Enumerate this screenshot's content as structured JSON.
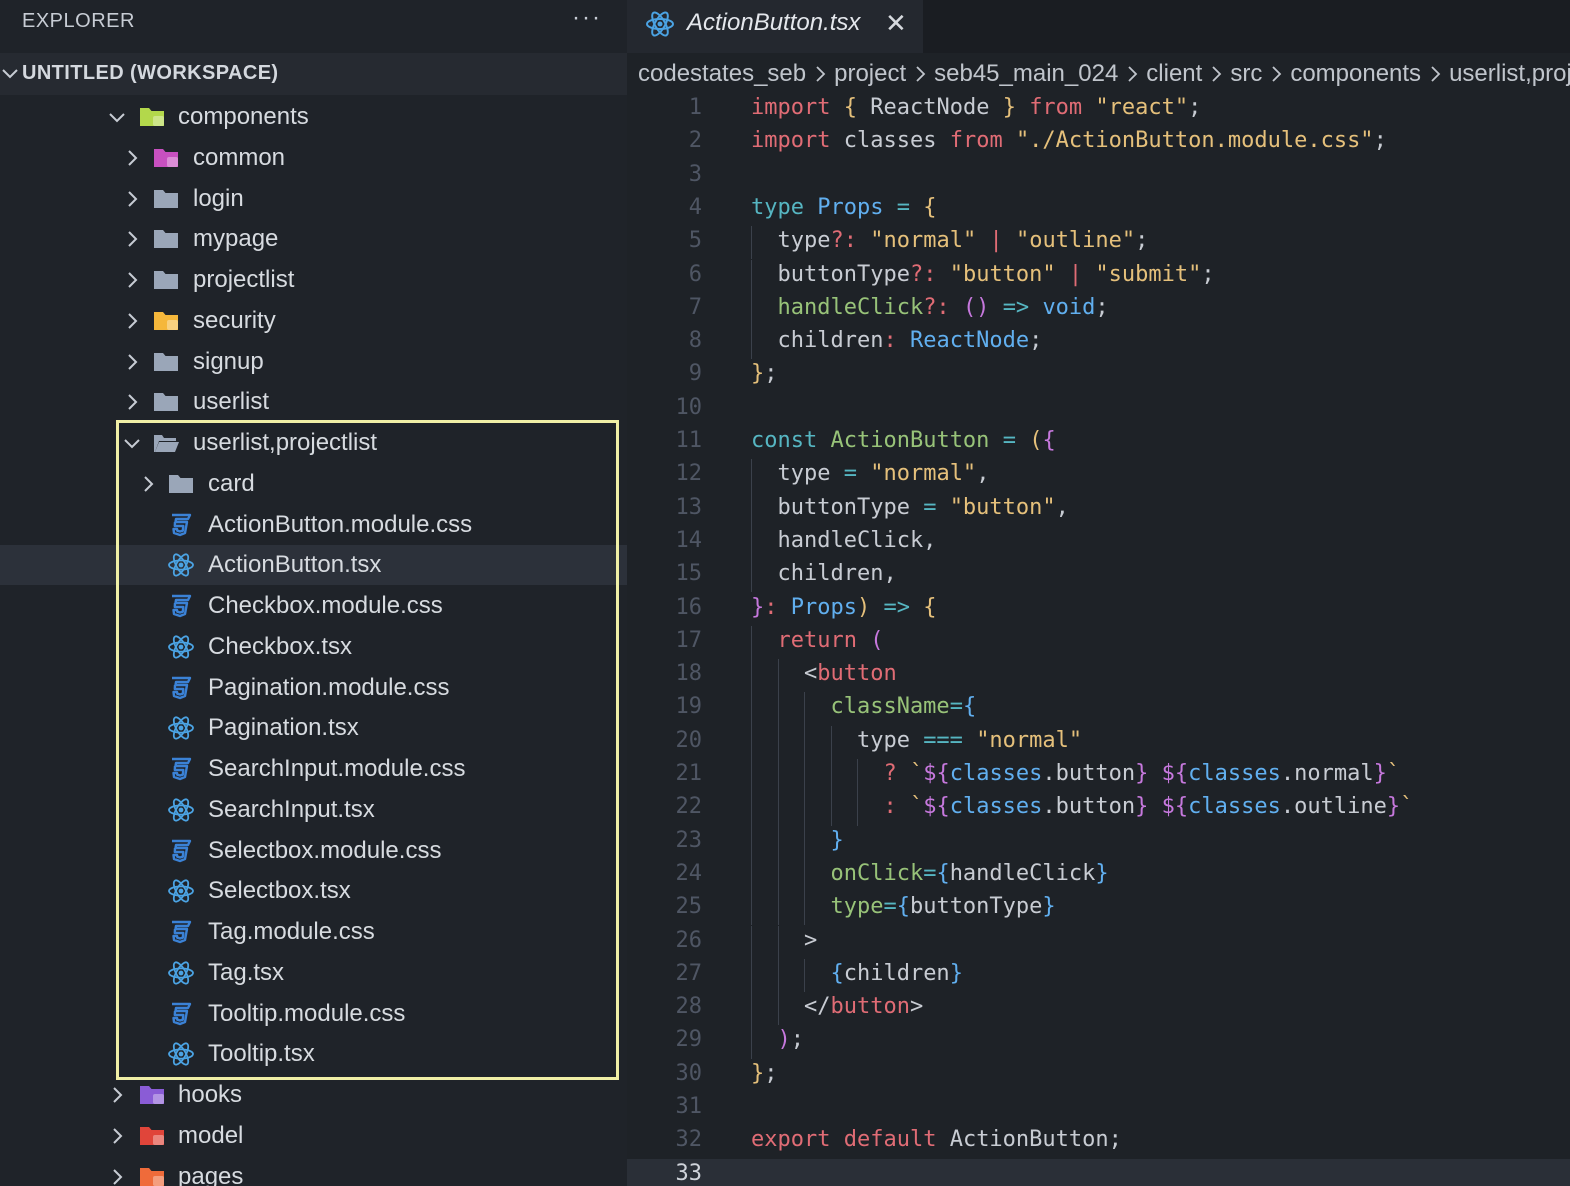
{
  "sidebar": {
    "title": "EXPLORER",
    "more_label": "···",
    "workspace_label": "UNTITLED (WORKSPACE)",
    "tree": [
      {
        "label": "components",
        "type": "folder-special",
        "expanded": true,
        "depth": 0,
        "color": "#b3d84b"
      },
      {
        "label": "common",
        "type": "folder-special",
        "expanded": false,
        "depth": 1,
        "color": "#c850c0"
      },
      {
        "label": "login",
        "type": "folder",
        "expanded": false,
        "depth": 1
      },
      {
        "label": "mypage",
        "type": "folder",
        "expanded": false,
        "depth": 1
      },
      {
        "label": "projectlist",
        "type": "folder",
        "expanded": false,
        "depth": 1
      },
      {
        "label": "security",
        "type": "folder-special",
        "expanded": false,
        "depth": 1,
        "color": "#f5b73b"
      },
      {
        "label": "signup",
        "type": "folder",
        "expanded": false,
        "depth": 1
      },
      {
        "label": "userlist",
        "type": "folder",
        "expanded": false,
        "depth": 1
      },
      {
        "label": "userlist,projectlist",
        "type": "folder-open",
        "expanded": true,
        "depth": 1
      },
      {
        "label": "card",
        "type": "folder",
        "expanded": false,
        "depth": 2
      },
      {
        "label": "ActionButton.module.css",
        "type": "css",
        "depth": 2
      },
      {
        "label": "ActionButton.tsx",
        "type": "react",
        "depth": 2,
        "selected": true
      },
      {
        "label": "Checkbox.module.css",
        "type": "css",
        "depth": 2
      },
      {
        "label": "Checkbox.tsx",
        "type": "react",
        "depth": 2
      },
      {
        "label": "Pagination.module.css",
        "type": "css",
        "depth": 2
      },
      {
        "label": "Pagination.tsx",
        "type": "react",
        "depth": 2
      },
      {
        "label": "SearchInput.module.css",
        "type": "css",
        "depth": 2
      },
      {
        "label": "SearchInput.tsx",
        "type": "react",
        "depth": 2
      },
      {
        "label": "Selectbox.module.css",
        "type": "css",
        "depth": 2
      },
      {
        "label": "Selectbox.tsx",
        "type": "react",
        "depth": 2
      },
      {
        "label": "Tag.module.css",
        "type": "css",
        "depth": 2
      },
      {
        "label": "Tag.tsx",
        "type": "react",
        "depth": 2
      },
      {
        "label": "Tooltip.module.css",
        "type": "css",
        "depth": 2
      },
      {
        "label": "Tooltip.tsx",
        "type": "react",
        "depth": 2
      },
      {
        "label": "hooks",
        "type": "folder-special",
        "expanded": false,
        "depth": 0,
        "color": "#8a5cd6"
      },
      {
        "label": "model",
        "type": "folder-special",
        "expanded": false,
        "depth": 0,
        "color": "#e0453a"
      },
      {
        "label": "pages",
        "type": "folder-special",
        "expanded": false,
        "depth": 0,
        "color": "#ef6b3a"
      }
    ]
  },
  "editor": {
    "tab_label": "ActionButton.tsx",
    "tab_close": "✕",
    "breadcrumb": [
      "codestates_seb",
      "project",
      "seb45_main_024",
      "client",
      "src",
      "components",
      "userlist,projectlist"
    ],
    "current_line": 33,
    "lines": [
      [
        [
          "kw",
          "import"
        ],
        [
          "plain",
          " "
        ],
        [
          "y",
          "{"
        ],
        [
          "plain",
          " ReactNode "
        ],
        [
          "y",
          "}"
        ],
        [
          "plain",
          " "
        ],
        [
          "kw",
          "from"
        ],
        [
          "plain",
          " "
        ],
        [
          "str",
          "\"react\""
        ],
        [
          "plain",
          ";"
        ]
      ],
      [
        [
          "kw",
          "import"
        ],
        [
          "plain",
          " classes "
        ],
        [
          "kw",
          "from"
        ],
        [
          "plain",
          " "
        ],
        [
          "str",
          "\"./ActionButton.module.css\""
        ],
        [
          "plain",
          ";"
        ]
      ],
      [],
      [
        [
          "kwb",
          "type"
        ],
        [
          "plain",
          " "
        ],
        [
          "type",
          "Props"
        ],
        [
          "plain",
          " "
        ],
        [
          "op",
          "="
        ],
        [
          "plain",
          " "
        ],
        [
          "y",
          "{"
        ]
      ],
      [
        [
          "plain",
          "  type"
        ],
        [
          "kw",
          "?:"
        ],
        [
          "plain",
          " "
        ],
        [
          "str",
          "\"normal\""
        ],
        [
          "plain",
          " "
        ],
        [
          "kw",
          "|"
        ],
        [
          "plain",
          " "
        ],
        [
          "str",
          "\"outline\""
        ],
        [
          "plain",
          ";"
        ]
      ],
      [
        [
          "plain",
          "  buttonType"
        ],
        [
          "kw",
          "?:"
        ],
        [
          "plain",
          " "
        ],
        [
          "str",
          "\"button\""
        ],
        [
          "plain",
          " "
        ],
        [
          "kw",
          "|"
        ],
        [
          "plain",
          " "
        ],
        [
          "str",
          "\"submit\""
        ],
        [
          "plain",
          ";"
        ]
      ],
      [
        [
          "fn",
          "  handleClick"
        ],
        [
          "kw",
          "?:"
        ],
        [
          "plain",
          " "
        ],
        [
          "p",
          "()"
        ],
        [
          "plain",
          " "
        ],
        [
          "op",
          "=>"
        ],
        [
          "plain",
          " "
        ],
        [
          "type",
          "void"
        ],
        [
          "plain",
          ";"
        ]
      ],
      [
        [
          "plain",
          "  children"
        ],
        [
          "kw",
          ":"
        ],
        [
          "plain",
          " "
        ],
        [
          "type",
          "ReactNode"
        ],
        [
          "plain",
          ";"
        ]
      ],
      [
        [
          "y",
          "}"
        ],
        [
          "plain",
          ";"
        ]
      ],
      [],
      [
        [
          "kwb",
          "const"
        ],
        [
          "plain",
          " "
        ],
        [
          "fn",
          "ActionButton"
        ],
        [
          "plain",
          " "
        ],
        [
          "op",
          "="
        ],
        [
          "plain",
          " "
        ],
        [
          "y",
          "("
        ],
        [
          "p",
          "{"
        ]
      ],
      [
        [
          "plain",
          "  type "
        ],
        [
          "op",
          "="
        ],
        [
          "plain",
          " "
        ],
        [
          "str",
          "\"normal\""
        ],
        [
          "plain",
          ","
        ]
      ],
      [
        [
          "plain",
          "  buttonType "
        ],
        [
          "op",
          "="
        ],
        [
          "plain",
          " "
        ],
        [
          "str",
          "\"button\""
        ],
        [
          "plain",
          ","
        ]
      ],
      [
        [
          "plain",
          "  handleClick,"
        ]
      ],
      [
        [
          "plain",
          "  children,"
        ]
      ],
      [
        [
          "p",
          "}"
        ],
        [
          "kw",
          ":"
        ],
        [
          "plain",
          " "
        ],
        [
          "type",
          "Props"
        ],
        [
          "y",
          ")"
        ],
        [
          "plain",
          " "
        ],
        [
          "op",
          "=>"
        ],
        [
          "plain",
          " "
        ],
        [
          "y",
          "{"
        ]
      ],
      [
        [
          "kw",
          "  return"
        ],
        [
          "plain",
          " "
        ],
        [
          "p",
          "("
        ]
      ],
      [
        [
          "plain",
          "    <"
        ],
        [
          "tag",
          "button"
        ]
      ],
      [
        [
          "attr",
          "      className"
        ],
        [
          "op",
          "="
        ],
        [
          "b",
          "{"
        ]
      ],
      [
        [
          "plain",
          "        type "
        ],
        [
          "op",
          "==="
        ],
        [
          "plain",
          " "
        ],
        [
          "str",
          "\"normal\""
        ]
      ],
      [
        [
          "kw",
          "          ?"
        ],
        [
          "plain",
          " "
        ],
        [
          "str",
          "`"
        ],
        [
          "p",
          "${"
        ],
        [
          "b",
          "classes"
        ],
        [
          "plain",
          "."
        ],
        [
          "plain",
          "button"
        ],
        [
          "p",
          "}"
        ],
        [
          "plain",
          " "
        ],
        [
          "p",
          "${"
        ],
        [
          "b",
          "classes"
        ],
        [
          "plain",
          ".normal"
        ],
        [
          "p",
          "}"
        ],
        [
          "str",
          "`"
        ]
      ],
      [
        [
          "kw",
          "          :"
        ],
        [
          "plain",
          " "
        ],
        [
          "str",
          "`"
        ],
        [
          "p",
          "${"
        ],
        [
          "b",
          "classes"
        ],
        [
          "plain",
          "."
        ],
        [
          "plain",
          "button"
        ],
        [
          "p",
          "}"
        ],
        [
          "plain",
          " "
        ],
        [
          "p",
          "${"
        ],
        [
          "b",
          "classes"
        ],
        [
          "plain",
          ".outline"
        ],
        [
          "p",
          "}"
        ],
        [
          "str",
          "`"
        ]
      ],
      [
        [
          "b",
          "      }"
        ]
      ],
      [
        [
          "attr",
          "      onClick"
        ],
        [
          "op",
          "="
        ],
        [
          "b",
          "{"
        ],
        [
          "plain",
          "handleClick"
        ],
        [
          "b",
          "}"
        ]
      ],
      [
        [
          "attr",
          "      type"
        ],
        [
          "op",
          "="
        ],
        [
          "b",
          "{"
        ],
        [
          "plain",
          "buttonType"
        ],
        [
          "b",
          "}"
        ]
      ],
      [
        [
          "plain",
          "    >"
        ]
      ],
      [
        [
          "b",
          "      {"
        ],
        [
          "plain",
          "children"
        ],
        [
          "b",
          "}"
        ]
      ],
      [
        [
          "plain",
          "    </"
        ],
        [
          "tag",
          "button"
        ],
        [
          "plain",
          ">"
        ]
      ],
      [
        [
          "p",
          "  )"
        ],
        [
          "plain",
          ";"
        ]
      ],
      [
        [
          "y",
          "}"
        ],
        [
          "plain",
          ";"
        ]
      ],
      [],
      [
        [
          "kw",
          "export"
        ],
        [
          "plain",
          " "
        ],
        [
          "kw",
          "default"
        ],
        [
          "plain",
          " ActionButton;"
        ]
      ],
      []
    ]
  },
  "colors": {
    "highlight_border": "#f0efa6",
    "css_icon": "#3b82d6",
    "react_icon": "#4ba3e3",
    "folder_gray": "#9aa6b8"
  }
}
